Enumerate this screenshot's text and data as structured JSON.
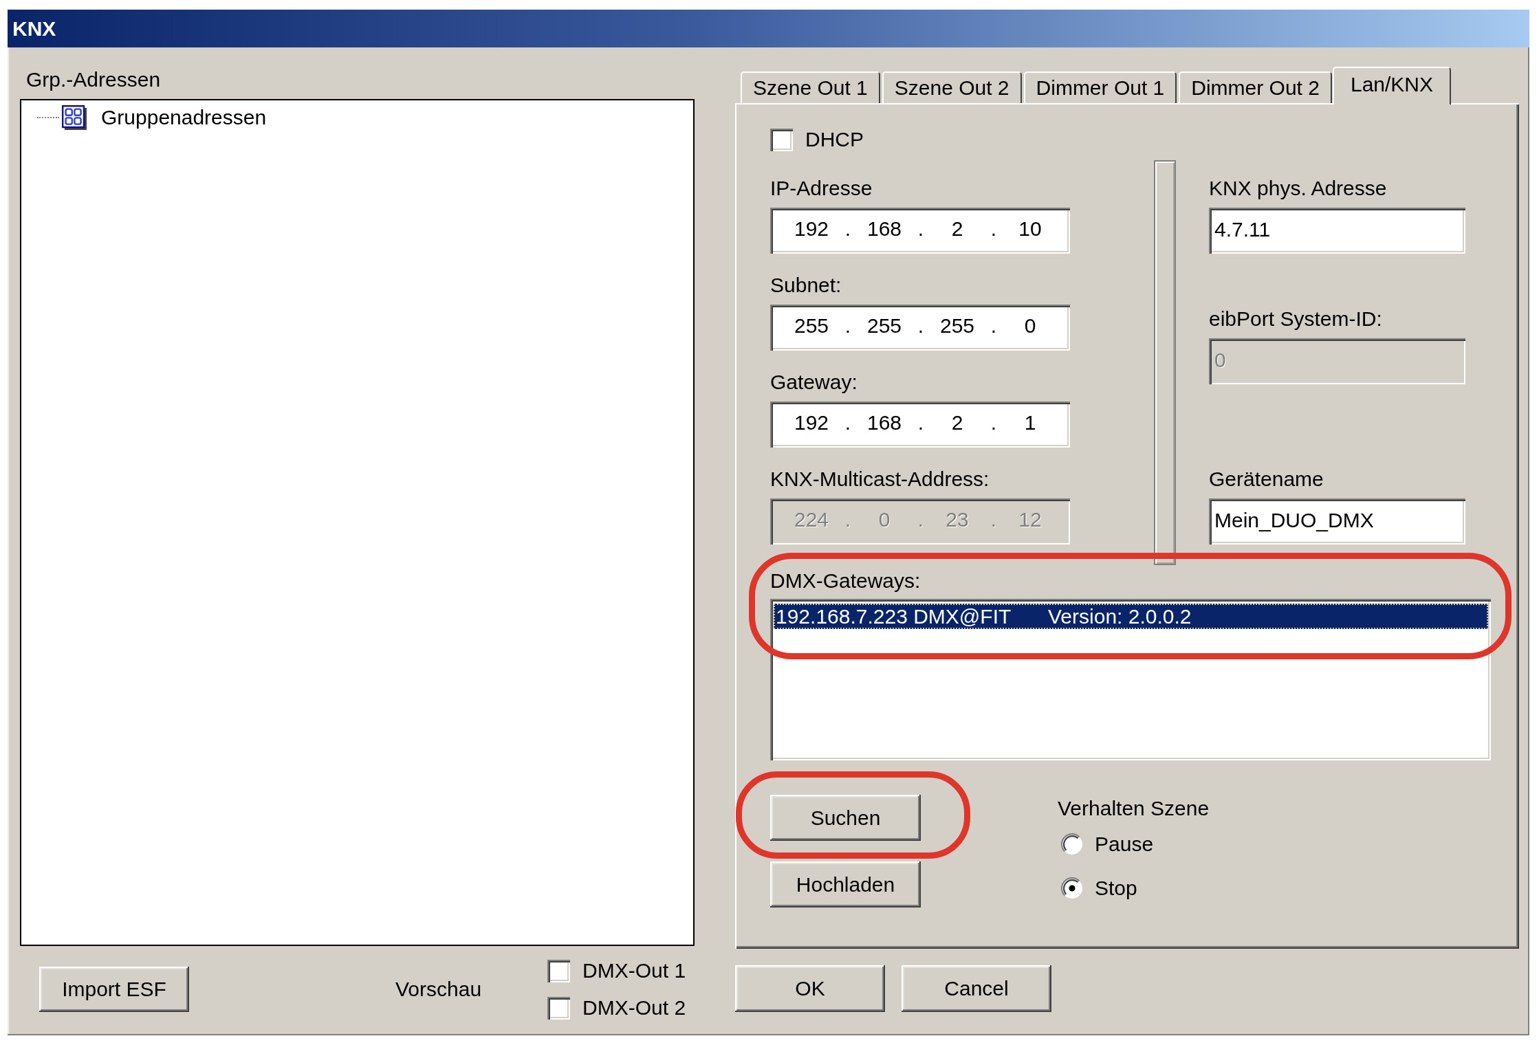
{
  "window": {
    "title": "KNX"
  },
  "group_addresses": {
    "label": "Grp.-Adressen",
    "tree": [
      {
        "label": "Gruppenadressen"
      }
    ]
  },
  "tabs": [
    {
      "label": "Szene Out 1",
      "selected": false
    },
    {
      "label": "Szene Out 2",
      "selected": false
    },
    {
      "label": "Dimmer Out 1",
      "selected": false
    },
    {
      "label": "Dimmer Out 2",
      "selected": false
    },
    {
      "label": "Lan/KNX",
      "selected": true
    }
  ],
  "lan_knx": {
    "dhcp": {
      "label": "DHCP",
      "checked": false
    },
    "ip_fields": [
      {
        "label": "IP-Adresse",
        "parts": [
          "192",
          ".",
          "168",
          ".",
          "2",
          ".",
          "10"
        ],
        "disabled": false
      },
      {
        "label": "Subnet:",
        "parts": [
          "255",
          ".",
          "255",
          ".",
          "255",
          ".",
          "0"
        ],
        "disabled": false
      },
      {
        "label": "Gateway:",
        "parts": [
          "192",
          ".",
          "168",
          ".",
          "2",
          ".",
          "1"
        ],
        "disabled": false
      },
      {
        "label": "KNX-Multicast-Address:",
        "parts": [
          "224",
          ".",
          "0",
          ".",
          "23",
          ".",
          "12"
        ],
        "disabled": true
      }
    ],
    "device_fields": [
      {
        "label": "KNX phys. Adresse",
        "value": "4.7.11",
        "disabled": false
      },
      {
        "label": "eibPort System-ID:",
        "value": "0",
        "disabled": true
      },
      {
        "label": "Gerätename",
        "value": "Mein_DUO_DMX",
        "disabled": false
      }
    ],
    "gateways": {
      "label": "DMX-Gateways:",
      "highlighted": true,
      "items": [
        {
          "address": "192.168.7.223 DMX@FIT",
          "version": "Version: 2.0.0.2",
          "selected": true
        }
      ]
    },
    "actions": [
      {
        "label": "Suchen",
        "highlighted": true
      },
      {
        "label": "Hochladen",
        "highlighted": false
      }
    ],
    "scene_behavior": {
      "label": "Verhalten Szene",
      "options": [
        {
          "label": "Pause",
          "selected": false
        },
        {
          "label": "Stop",
          "selected": true
        }
      ]
    }
  },
  "left_buttons": [
    {
      "label": "Import ESF"
    }
  ],
  "preview": {
    "label": "Vorschau",
    "outputs": [
      {
        "label": "DMX-Out 1",
        "checked": false
      },
      {
        "label": "DMX-Out 2",
        "checked": false
      }
    ]
  },
  "dialog_buttons": [
    {
      "label": "OK"
    },
    {
      "label": "Cancel"
    }
  ]
}
